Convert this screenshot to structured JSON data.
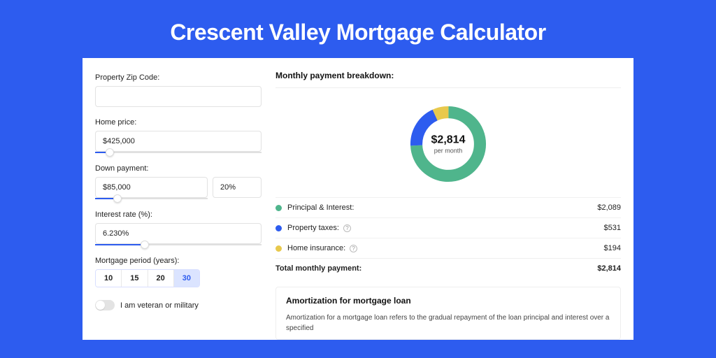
{
  "page": {
    "title": "Crescent Valley Mortgage Calculator"
  },
  "form": {
    "zip_label": "Property Zip Code:",
    "zip_value": "",
    "home_price_label": "Home price:",
    "home_price_value": "$425,000",
    "home_price_slider_pct": 9,
    "down_label": "Down payment:",
    "down_amount": "$85,000",
    "down_pct": "20%",
    "down_slider_pct": 20,
    "rate_label": "Interest rate (%):",
    "rate_value": "6.230%",
    "rate_slider_pct": 30,
    "period_label": "Mortgage period (years):",
    "periods": [
      "10",
      "15",
      "20",
      "30"
    ],
    "period_selected_index": 3,
    "veteran_label": "I am veteran or military",
    "veteran_on": false
  },
  "breakdown": {
    "heading": "Monthly payment breakdown:",
    "center_value": "$2,814",
    "center_sub": "per month",
    "rows": {
      "pi": {
        "label": "Principal & Interest:",
        "value": "$2,089"
      },
      "tax": {
        "label": "Property taxes:",
        "value": "$531"
      },
      "ins": {
        "label": "Home insurance:",
        "value": "$194"
      }
    },
    "total_label": "Total monthly payment:",
    "total_value": "$2,814"
  },
  "amort": {
    "heading": "Amortization for mortgage loan",
    "body": "Amortization for a mortgage loan refers to the gradual repayment of the loan principal and interest over a specified"
  },
  "chart_data": {
    "type": "pie",
    "title": "Monthly payment breakdown",
    "series": [
      {
        "name": "Principal & Interest",
        "value": 2089,
        "color": "#4fb58c"
      },
      {
        "name": "Property taxes",
        "value": 531,
        "color": "#2d5cef"
      },
      {
        "name": "Home insurance",
        "value": 194,
        "color": "#e8c94d"
      }
    ],
    "total": 2814
  }
}
